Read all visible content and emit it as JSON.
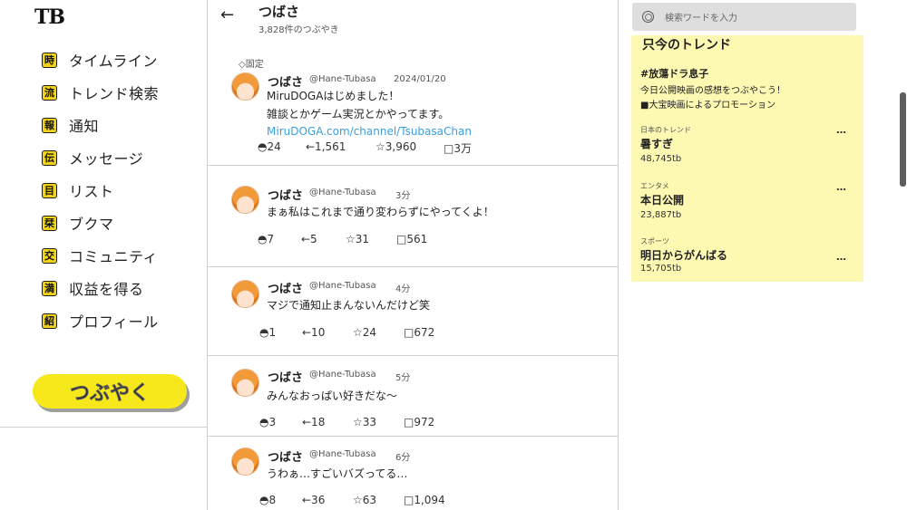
{
  "app": {
    "logo": "TB"
  },
  "nav": [
    {
      "icon": "時",
      "label": "タイムライン"
    },
    {
      "icon": "流",
      "label": "トレンド検索"
    },
    {
      "icon": "報",
      "label": "通知"
    },
    {
      "icon": "伝",
      "label": "メッセージ"
    },
    {
      "icon": "目",
      "label": "リスト"
    },
    {
      "icon": "栞",
      "label": "ブクマ"
    },
    {
      "icon": "交",
      "label": "コミュニティ"
    },
    {
      "icon": "満",
      "label": "収益を得る"
    },
    {
      "icon": "紹",
      "label": "プロフィール"
    }
  ],
  "compose_button": "つぶやく",
  "profile": {
    "back": "←",
    "name": "つばさ",
    "count": "3,828件のつぶやき"
  },
  "tweets": [
    {
      "pinned": "◇固定",
      "name": "つばさ",
      "handle": "@Hane-Tubasa",
      "time": "2024/01/20",
      "lines": [
        "MiruDOGAはじめました！",
        "雑談とかゲーム実況とかやってます。"
      ],
      "link": "MiruDOGA.com/channel/TsubasaChan",
      "reply": "◓24",
      "retweet": "←1,561",
      "like": "☆3,960",
      "views": "□3万"
    },
    {
      "name": "つばさ",
      "handle": "@Hane-Tubasa",
      "time": "3分",
      "lines": [
        "まぁ私はこれまで通り変わらずにやってくよ！"
      ],
      "reply": "◓7",
      "retweet": "←5",
      "like": "☆31",
      "views": "□561"
    },
    {
      "name": "つばさ",
      "handle": "@Hane-Tubasa",
      "time": "4分",
      "lines": [
        "マジで通知止まんないんだけど笑"
      ],
      "reply": "◓1",
      "retweet": "←10",
      "like": "☆24",
      "views": "□672"
    },
    {
      "name": "つばさ",
      "handle": "@Hane-Tubasa",
      "time": "5分",
      "lines": [
        "みんなおっぱい好きだな～"
      ],
      "reply": "◓3",
      "retweet": "←18",
      "like": "☆33",
      "views": "□972"
    },
    {
      "name": "つばさ",
      "handle": "@Hane-Tubasa",
      "time": "6分",
      "lines": [
        "うわぁ…すごいバズってる…"
      ],
      "reply": "◓8",
      "retweet": "←36",
      "like": "☆63",
      "views": "□1,094"
    }
  ],
  "search": {
    "placeholder": "検索ワードを入力"
  },
  "trends": {
    "title": "只今のトレンド",
    "promo": {
      "tag": "#放蕩ドラ息子",
      "desc": "今日公開映画の感想をつぶやこう！",
      "note": "■大宝映画によるプロモーション"
    },
    "items": [
      {
        "category": "日本のトレンド",
        "title": "暑すぎ",
        "count": "48,745tb",
        "more": "…"
      },
      {
        "category": "エンタメ",
        "title": "本日公開",
        "count": "23,887tb",
        "more": "…"
      },
      {
        "category": "スポーツ",
        "title": "明日からがんばる",
        "count": "15,705tb",
        "more": "…"
      }
    ]
  },
  "colors": {
    "accent_yellow": "#f7e81c",
    "trend_bg": "#fdf9b3",
    "link_blue": "#3a9fe0",
    "divider": "#cfcfcf"
  }
}
